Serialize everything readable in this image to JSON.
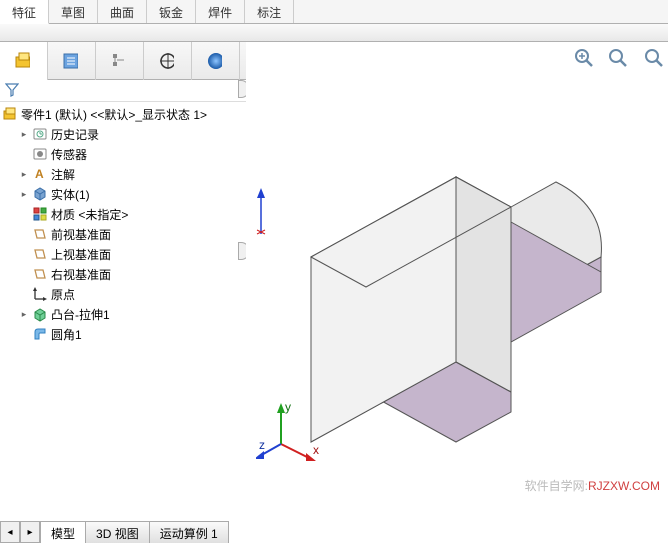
{
  "command_tabs": {
    "items": [
      {
        "label": "特征"
      },
      {
        "label": "草图"
      },
      {
        "label": "曲面"
      },
      {
        "label": "钣金"
      },
      {
        "label": "焊件"
      },
      {
        "label": "标注"
      }
    ]
  },
  "panel_tabs": {
    "icons": [
      "feature-tree",
      "property",
      "config",
      "display",
      "appearance"
    ]
  },
  "part": {
    "name": "零件1 (默认) <<默认>_显示状态 1>"
  },
  "tree": {
    "history": "历史记录",
    "sensors": "传感器",
    "annotations": "注解",
    "solid": "实体(1)",
    "material": "材质 <未指定>",
    "front_plane": "前视基准面",
    "top_plane": "上视基准面",
    "right_plane": "右视基准面",
    "origin": "原点",
    "boss": "凸台-拉伸1",
    "fillet": "圆角1"
  },
  "bottom_tabs": {
    "items": [
      {
        "label": "模型"
      },
      {
        "label": "3D 视图"
      },
      {
        "label": "运动算例 1"
      }
    ]
  },
  "watermark": {
    "site": "软件自学网:",
    "url": "RJZXW.COM"
  },
  "axes": {
    "x": "x",
    "y": "y",
    "z": "z",
    "y2": "Y"
  },
  "view_tools": {
    "zoom_fit": "zoom-fit",
    "zoom_area": "zoom-area",
    "prev_view": "prev-view"
  }
}
